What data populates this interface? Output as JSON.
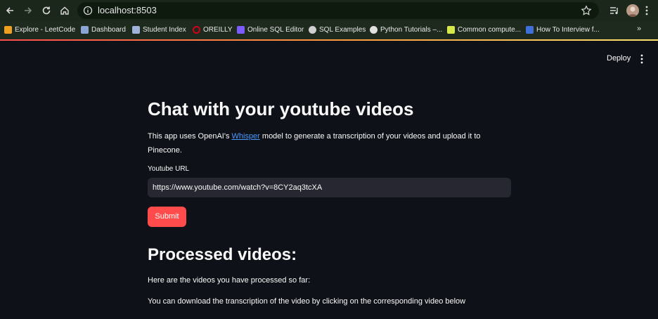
{
  "browser": {
    "url": "localhost:8503",
    "bookmarks": [
      {
        "label": "Explore - LeetCode",
        "icon": "leetcode-icon",
        "color": "#f0a020"
      },
      {
        "label": "Dashboard",
        "icon": "dashboard-icon",
        "color": "#8aa4d6"
      },
      {
        "label": "Student Index",
        "icon": "student-index-icon",
        "color": "#9fb3d9"
      },
      {
        "label": "OREILLY",
        "icon": "oreilly-icon",
        "color": "#d0021b"
      },
      {
        "label": "Online SQL Editor",
        "icon": "sql-editor-icon",
        "color": "#7a5cff"
      },
      {
        "label": "SQL Examples",
        "icon": "globe-icon",
        "color": "#cfcfcf"
      },
      {
        "label": "Python Tutorials –...",
        "icon": "python-icon",
        "color": "#e0e0e0"
      },
      {
        "label": "Common compute...",
        "icon": "common-compute-icon",
        "color": "#d6e84a"
      },
      {
        "label": "How To Interview f...",
        "icon": "interview-icon",
        "color": "#3f6fd8"
      }
    ],
    "more_label": "»"
  },
  "app": {
    "deploy_label": "Deploy",
    "title": "Chat with your youtube videos",
    "intro_before": "This app uses OpenAI's ",
    "intro_link": "Whisper",
    "intro_after": " model to generate a transcription of your videos and upload it to Pinecone.",
    "url_label": "Youtube URL",
    "url_value": "https://www.youtube.com/watch?v=8CY2aq3tcXA",
    "submit_label": "Submit",
    "processed_heading": "Processed videos:",
    "processed_text": "Here are the videos you have processed so far:",
    "download_text": "You can download the transcription of the video by clicking on the corresponding video below"
  },
  "colors": {
    "background": "#0e1117",
    "primary": "#ff4b4b",
    "input_bg": "#262730",
    "link": "#4b9bff"
  }
}
